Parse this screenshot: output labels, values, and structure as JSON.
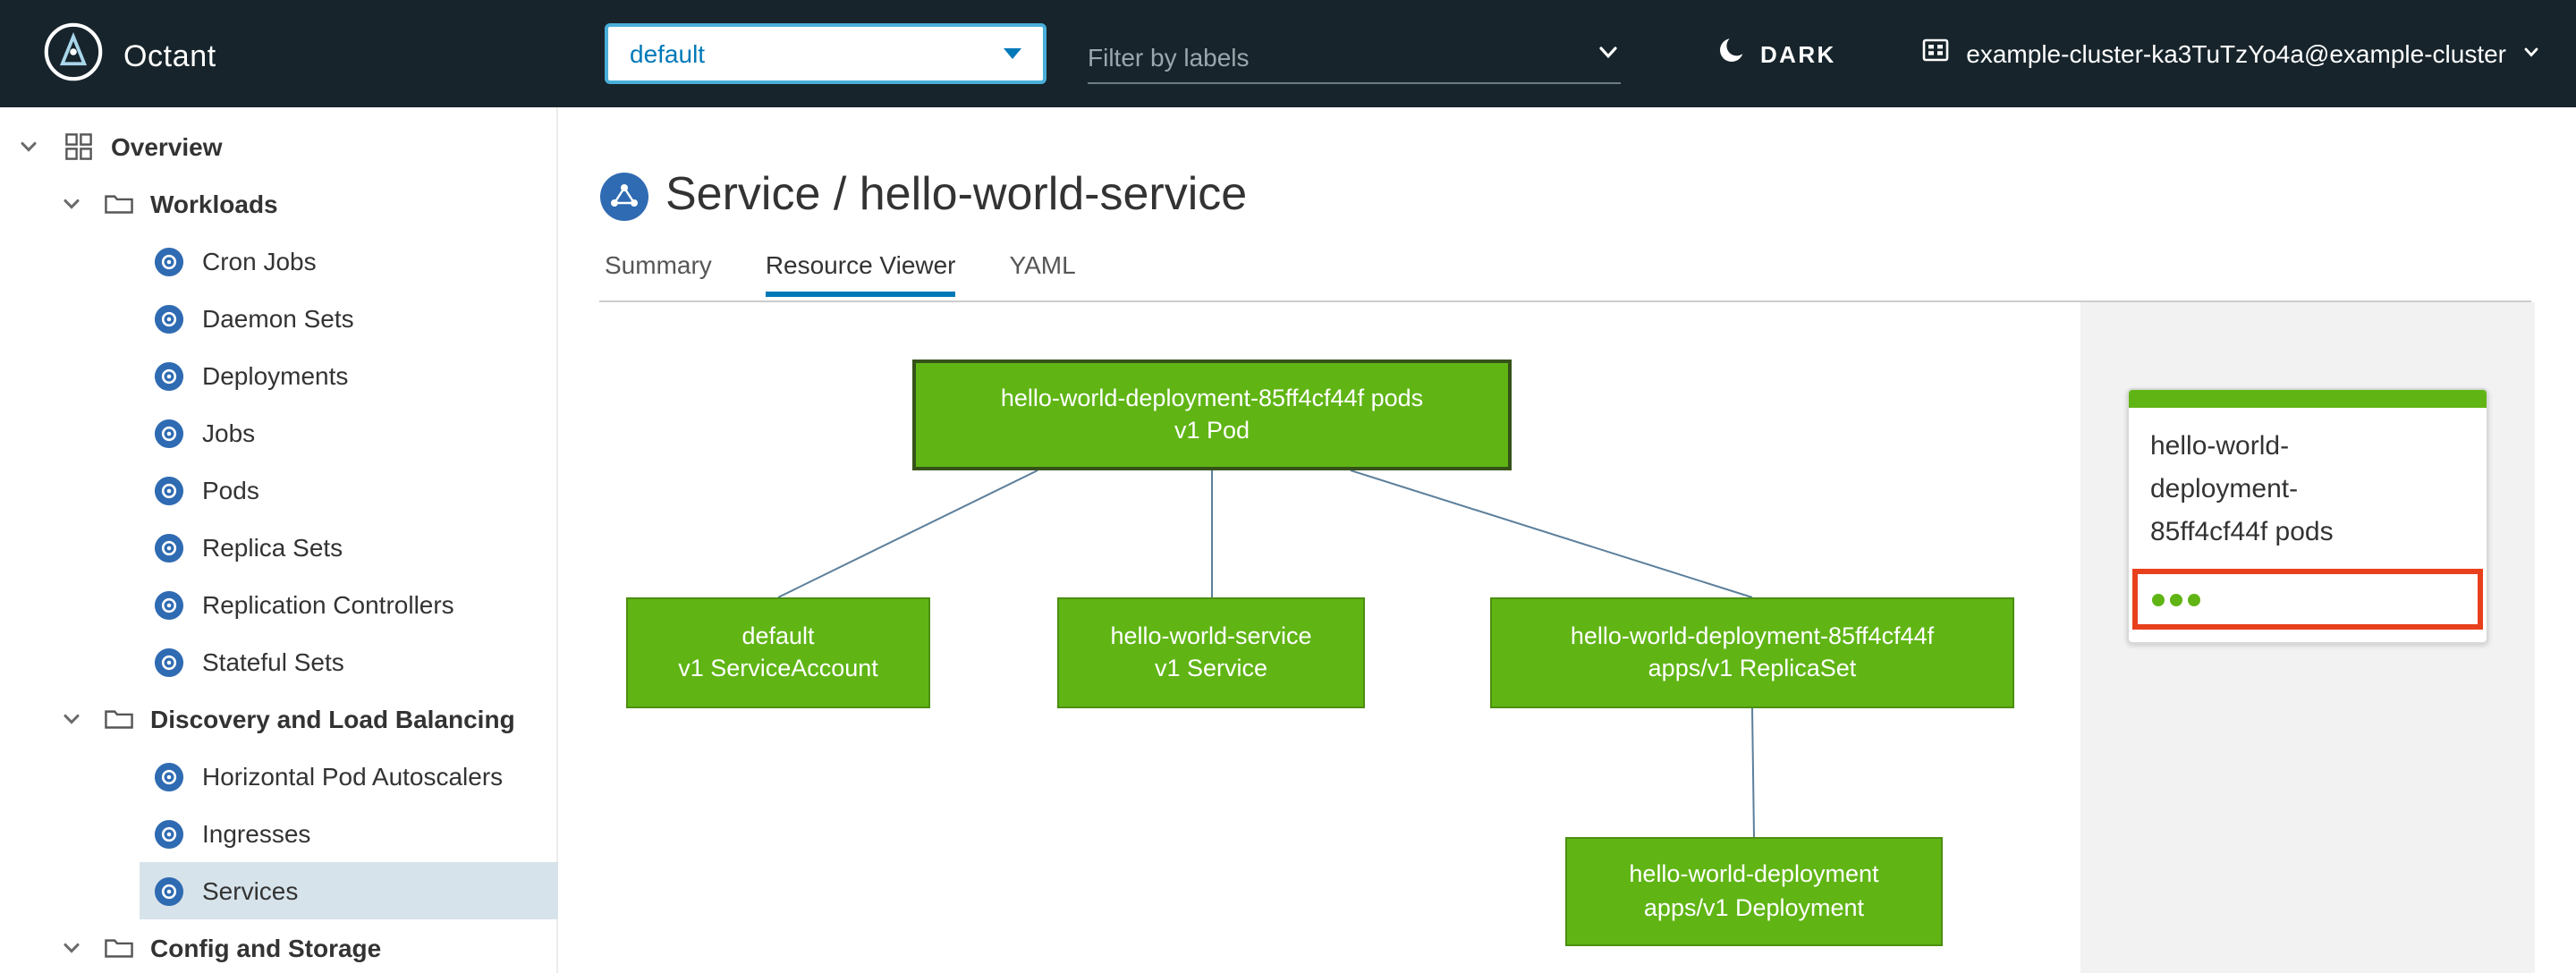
{
  "header": {
    "app_name": "Octant",
    "namespace": {
      "value": "default"
    },
    "filter": {
      "placeholder": "Filter by labels"
    },
    "theme": {
      "label": "DARK"
    },
    "context": {
      "label": "example-cluster-ka3TuTzYo4a@example-cluster"
    }
  },
  "sidebar": {
    "items": [
      {
        "label": "Overview"
      },
      {
        "label": "Workloads"
      },
      {
        "label": "Cron Jobs"
      },
      {
        "label": "Daemon Sets"
      },
      {
        "label": "Deployments"
      },
      {
        "label": "Jobs"
      },
      {
        "label": "Pods"
      },
      {
        "label": "Replica Sets"
      },
      {
        "label": "Replication Controllers"
      },
      {
        "label": "Stateful Sets"
      },
      {
        "label": "Discovery and Load Balancing"
      },
      {
        "label": "Horizontal Pod Autoscalers"
      },
      {
        "label": "Ingresses"
      },
      {
        "label": "Services"
      },
      {
        "label": "Config and Storage"
      }
    ]
  },
  "main": {
    "title": "Service / hello-world-service",
    "tabs": [
      {
        "label": "Summary",
        "active": false
      },
      {
        "label": "Resource Viewer",
        "active": true
      },
      {
        "label": "YAML",
        "active": false
      }
    ]
  },
  "graph": {
    "nodes": [
      {
        "id": "pod",
        "line1": "hello-world-deployment-85ff4cf44f pods",
        "line2": "v1 Pod",
        "selected": true
      },
      {
        "id": "serviceaccount",
        "line1": "default",
        "line2": "v1 ServiceAccount",
        "selected": false
      },
      {
        "id": "service",
        "line1": "hello-world-service",
        "line2": "v1 Service",
        "selected": false
      },
      {
        "id": "replicaset",
        "line1": "hello-world-deployment-85ff4cf44f",
        "line2": "apps/v1 ReplicaSet",
        "selected": false
      },
      {
        "id": "deployment",
        "line1": "hello-world-deployment",
        "line2": "apps/v1 Deployment",
        "selected": false
      }
    ],
    "edges": [
      [
        "pod",
        "serviceaccount"
      ],
      [
        "pod",
        "service"
      ],
      [
        "pod",
        "replicaset"
      ],
      [
        "replicaset",
        "deployment"
      ]
    ]
  },
  "panel": {
    "card_title": "hello-world-deployment-85ff4cf44f pods",
    "status_dot_count": 3
  },
  "icons": {
    "header": [
      "octant-logo",
      "moon-icon",
      "cluster-icon",
      "chevron-down-icon"
    ],
    "sidebar": [
      "chevron-down-icon",
      "overview-icon",
      "folder-icon",
      "k8s-resource-icon"
    ]
  },
  "colors": {
    "header_bg": "#17242b",
    "accent_blue": "#49afd9",
    "link_blue": "#0079b8",
    "icon_blue": "#2f6bb2",
    "node_green": "#60b515",
    "selection_red": "#e8401c",
    "selected_nav_bg": "#d7e3ea",
    "panel_bg": "#f2f2f2",
    "edge_line": "#5c7f9b"
  }
}
